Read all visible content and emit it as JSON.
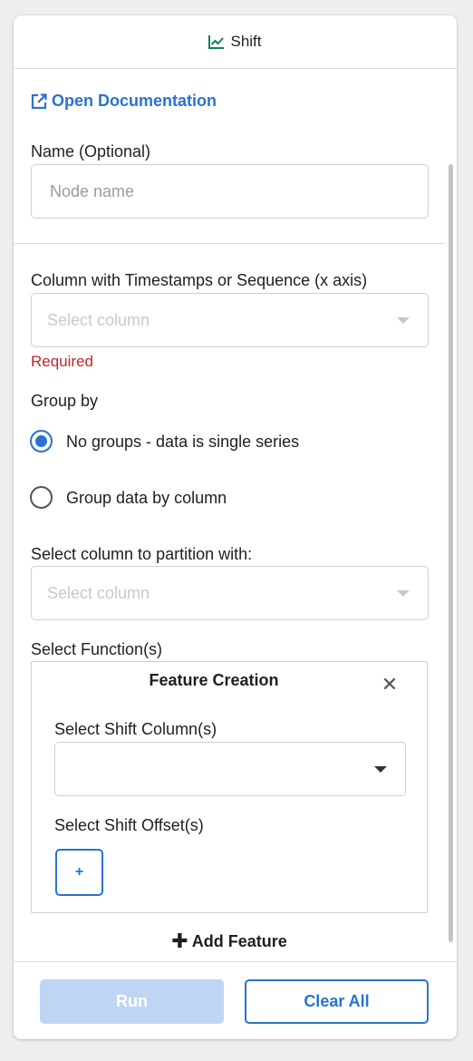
{
  "header": {
    "title": "Shift",
    "icon": "line-chart-icon"
  },
  "doc_link": {
    "label": "Open Documentation",
    "icon": "external-link-icon",
    "color": "#2a72d0"
  },
  "name_field": {
    "label": "Name (Optional)",
    "placeholder": "Node name",
    "value": ""
  },
  "x_axis": {
    "label": "Column with Timestamps or Sequence (x axis)",
    "placeholder": "Select column",
    "error": "Required",
    "error_color": "#c0242a"
  },
  "group_by": {
    "label": "Group by",
    "options": [
      {
        "label": "No groups - data is single series",
        "selected": true
      },
      {
        "label": "Group data by column",
        "selected": false
      }
    ]
  },
  "partition": {
    "label": "Select column to partition with:",
    "placeholder": "Select column"
  },
  "functions": {
    "label": "Select Function(s)",
    "card": {
      "title": "Feature Creation",
      "close_icon": "close-icon",
      "shift_columns_label": "Select Shift Column(s)",
      "shift_columns_value": "",
      "shift_offsets_label": "Select Shift Offset(s)",
      "add_offset_label": "+"
    },
    "add_feature_label": "Add Feature",
    "add_feature_icon": "plus-icon"
  },
  "footer": {
    "run_label": "Run",
    "clear_label": "Clear All",
    "run_disabled": true,
    "accent": "#2a72d0"
  }
}
